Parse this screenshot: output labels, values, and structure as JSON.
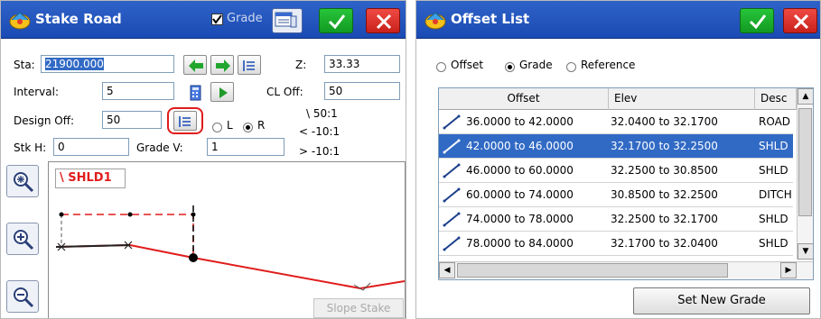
{
  "stake_road": {
    "title": "Stake Road",
    "grade_label": "Grade",
    "grade_checked": true,
    "sta_label": "Sta:",
    "sta_value": "21900.000",
    "z_label": "Z:",
    "z_value": "33.33",
    "interval_label": "Interval:",
    "interval_value": "5",
    "cl_off_label": "CL Off:",
    "cl_off_value": "50",
    "design_off_label": "Design Off:",
    "design_off_value": "50",
    "radio_left": "L",
    "radio_right": "R",
    "radio_selected": "R",
    "slope_ratio_1": "\\ 50:1",
    "slope_ratio_2": "< -10:1",
    "slope_ratio_3": "> -10:1",
    "stk_h_label": "Stk H:",
    "stk_h_value": "0",
    "grade_v_label": "Grade V:",
    "grade_v_value": "1",
    "section_tag": "\\ SHLD1",
    "slope_stake_label": "Slope Stake"
  },
  "offset_list": {
    "title": "Offset List",
    "mode_options": [
      "Offset",
      "Grade",
      "Reference"
    ],
    "mode_selected": "Grade",
    "columns": [
      "Offset",
      "Elev",
      "Desc"
    ],
    "rows": [
      {
        "offset": "36.0000 to 42.0000",
        "elev": "32.0400 to 32.1700",
        "desc": "ROAD"
      },
      {
        "offset": "42.0000 to 46.0000",
        "elev": "32.1700 to 32.2500",
        "desc": "SHLD"
      },
      {
        "offset": "46.0000 to 60.0000",
        "elev": "32.2500 to 30.8500",
        "desc": "SHLD"
      },
      {
        "offset": "60.0000 to 74.0000",
        "elev": "30.8500 to 32.2500",
        "desc": "DITCH"
      },
      {
        "offset": "74.0000 to 78.0000",
        "elev": "32.2500 to 32.1700",
        "desc": "SHLD"
      },
      {
        "offset": "78.0000 to 84.0000",
        "elev": "32.1700 to 32.0400",
        "desc": "SHLD"
      }
    ],
    "selected_row": 1,
    "set_new_grade_label": "Set New Grade"
  },
  "colors": {
    "titlebar": "#2f63c8",
    "ok": "#22b532",
    "close": "#dd332c",
    "selection": "#316ac5",
    "design_line": "#e01c1c"
  }
}
